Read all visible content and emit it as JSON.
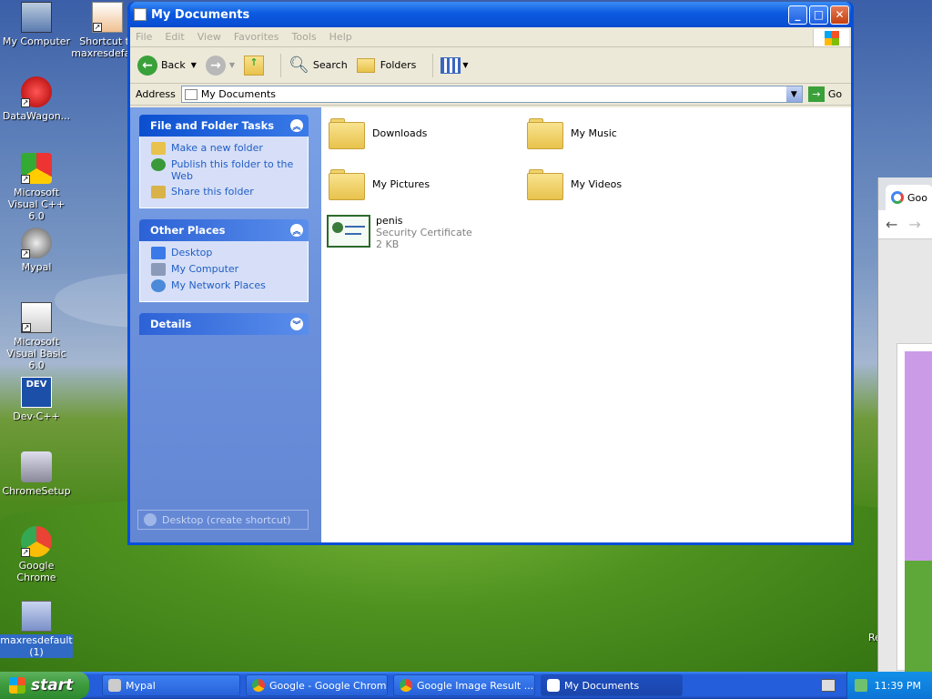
{
  "desktop": {
    "icons": [
      {
        "label": "My Computer",
        "icon": "my-computer-icon"
      },
      {
        "label": "Shortcut to maxresdefault",
        "icon": "image-shortcut-icon"
      },
      {
        "label": "DataWagon...",
        "icon": "datawagon-icon"
      },
      {
        "label": "Microsoft Visual C++ 6.0",
        "icon": "visual-cpp-icon"
      },
      {
        "label": "Mypal",
        "icon": "mypal-icon"
      },
      {
        "label": "Microsoft Visual Basic 6.0",
        "icon": "visual-basic-icon"
      },
      {
        "label": "Dev-C++",
        "icon": "dev-cpp-icon"
      },
      {
        "label": "ChromeSetup",
        "icon": "chrome-setup-icon"
      },
      {
        "label": "Google Chrome",
        "icon": "google-chrome-icon"
      },
      {
        "label": "maxresdefault (1)",
        "icon": "image-file-icon"
      },
      {
        "label": "Rec",
        "icon": "recycle-bin-icon"
      }
    ]
  },
  "window": {
    "title": "My Documents",
    "menu": [
      "File",
      "Edit",
      "View",
      "Favorites",
      "Tools",
      "Help"
    ],
    "toolbar": {
      "back": "Back",
      "search": "Search",
      "folders": "Folders"
    },
    "address": {
      "label": "Address",
      "value": "My Documents",
      "go": "Go"
    },
    "tasks": {
      "file_folder": {
        "title": "File and Folder Tasks",
        "items": [
          "Make a new folder",
          "Publish this folder to the Web",
          "Share this folder"
        ]
      },
      "other_places": {
        "title": "Other Places",
        "items": [
          "Desktop",
          "My Computer",
          "My Network Places"
        ]
      },
      "details": {
        "title": "Details"
      },
      "shortcut": "Desktop (create shortcut)"
    },
    "files": [
      {
        "name": "Downloads",
        "type": "folder"
      },
      {
        "name": "My Music",
        "type": "folder"
      },
      {
        "name": "My Pictures",
        "type": "folder"
      },
      {
        "name": "My Videos",
        "type": "folder"
      },
      {
        "name": "penis",
        "type": "Security Certificate",
        "size": "2 KB"
      }
    ]
  },
  "chrome_bg": {
    "tab_text": "Goo"
  },
  "taskbar": {
    "start": "start",
    "tasks": [
      "Mypal",
      "Google - Google Chrome",
      "Google Image Result ...",
      "My Documents"
    ],
    "clock": "11:39 PM"
  },
  "colors": {
    "title_blue": "#0b5ae0",
    "task_pane": "#6a8fdb",
    "start_green": "#3c9a3c",
    "link_blue": "#215dc6"
  }
}
